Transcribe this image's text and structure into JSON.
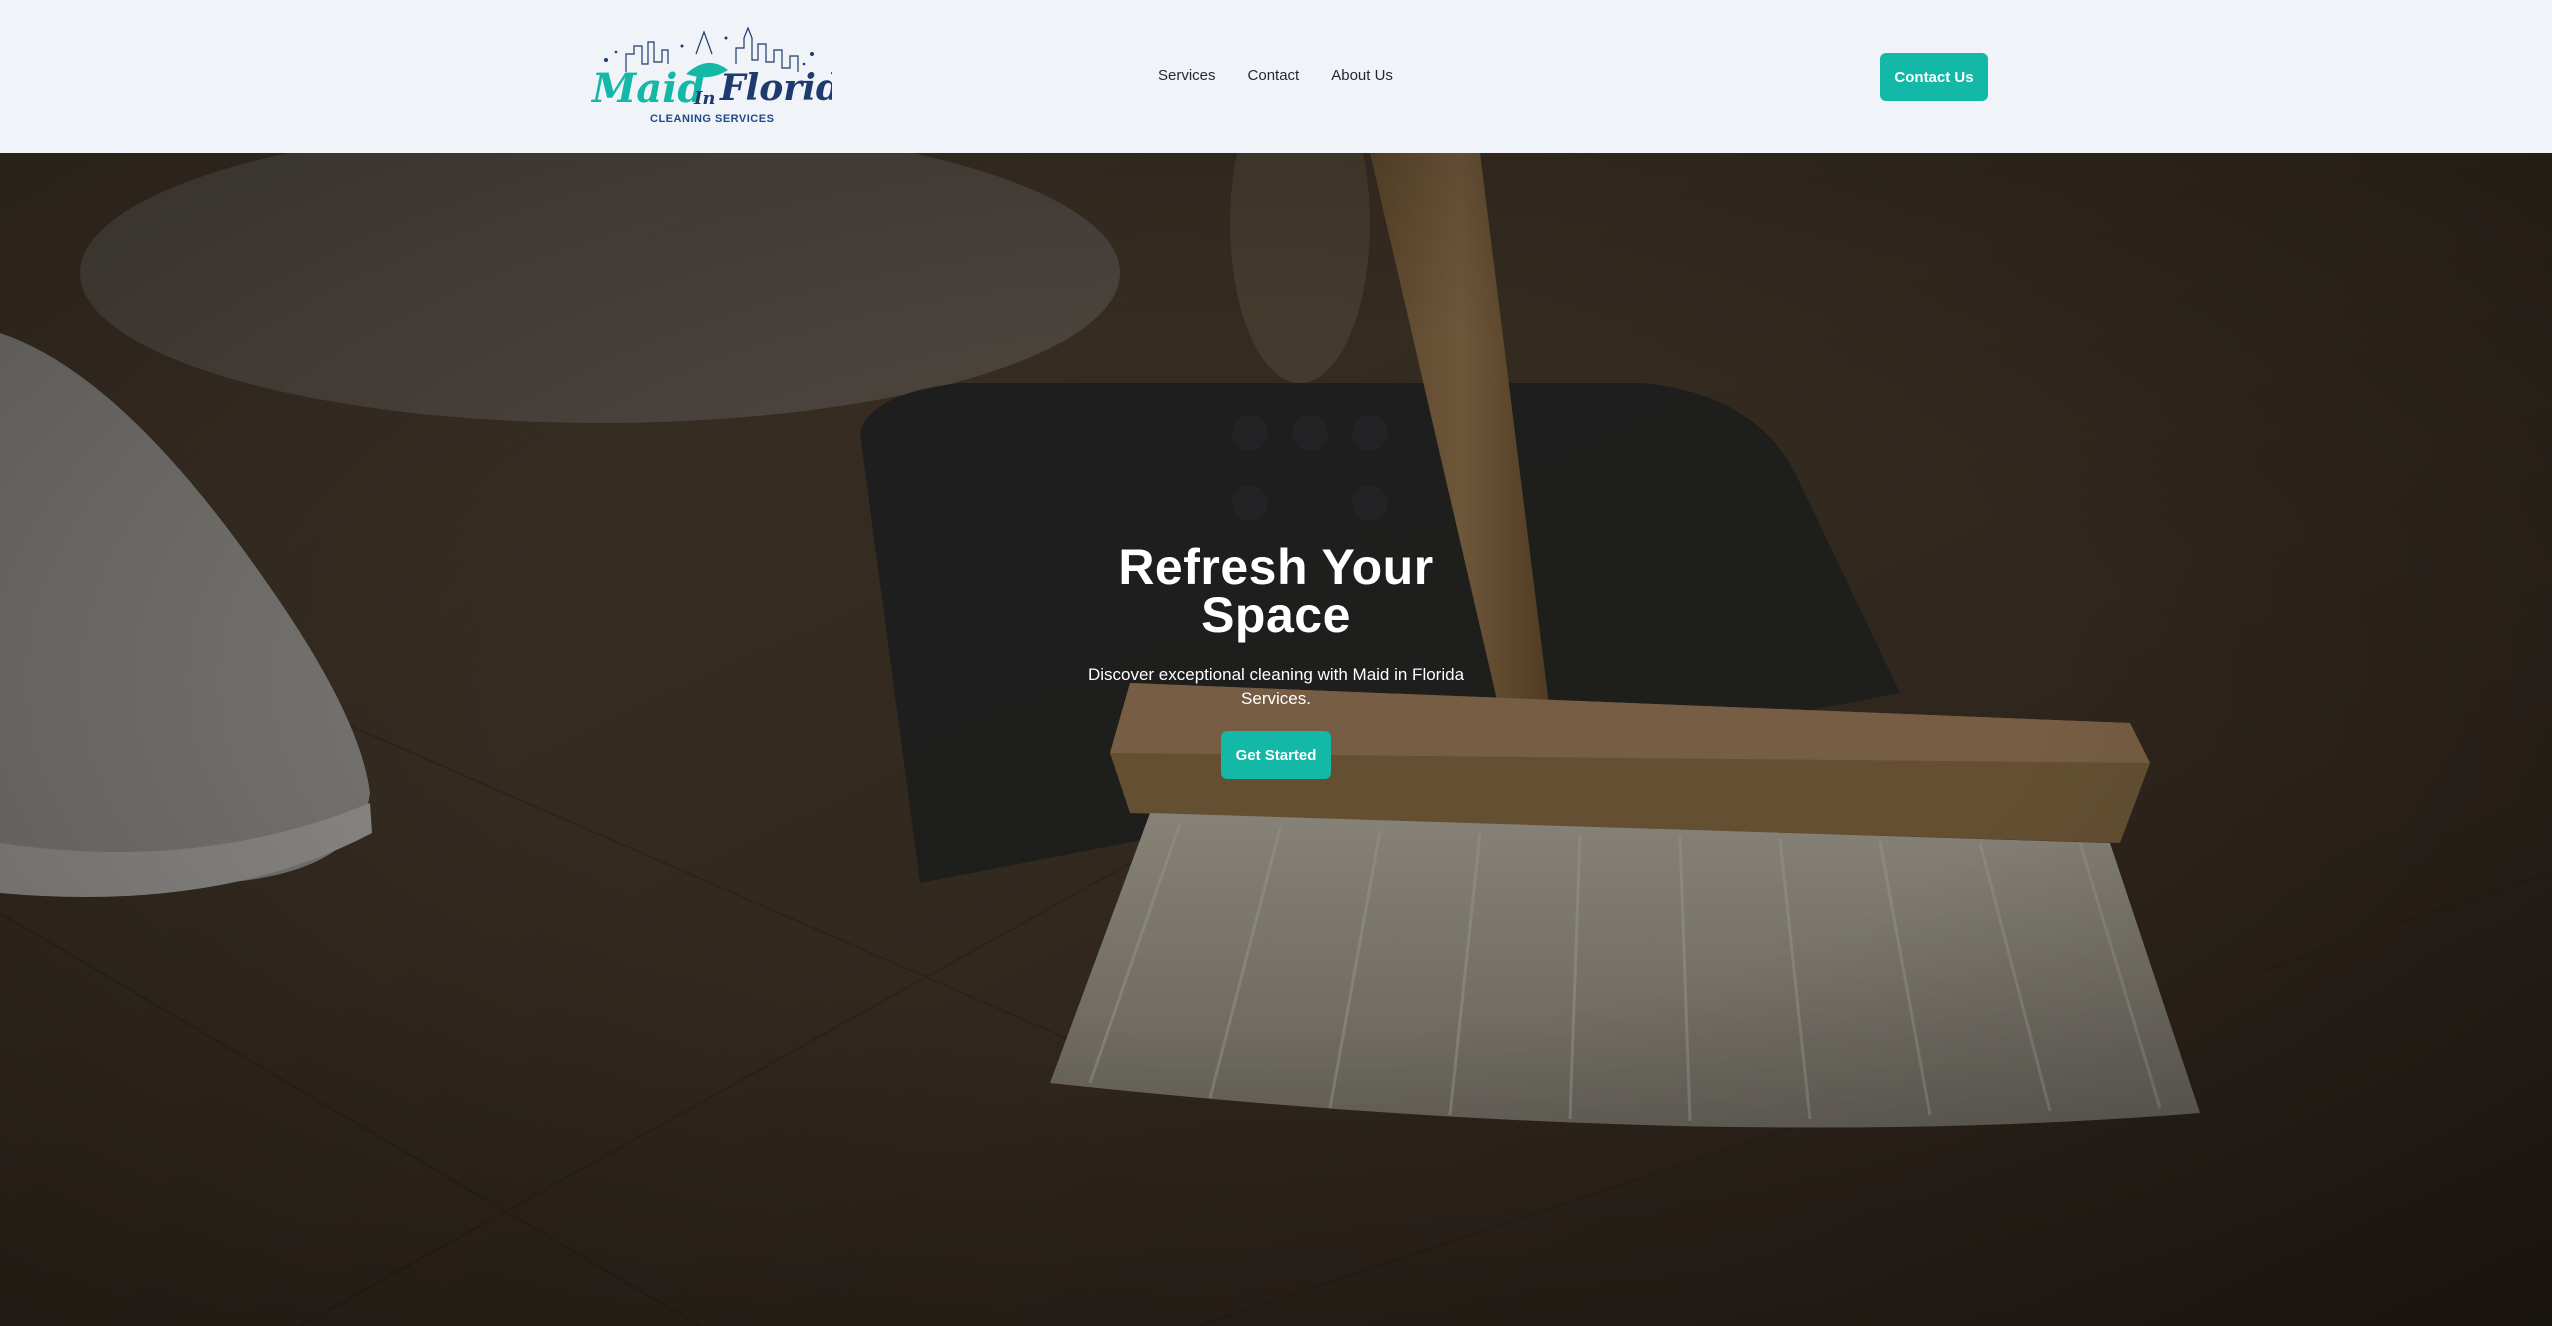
{
  "brand": {
    "script_left": "Maid",
    "script_mid": "In",
    "script_right": "Florida",
    "tagline": "CLEANING SERVICES",
    "colors": {
      "teal": "#14b8a6",
      "navy": "#1e3a6e"
    }
  },
  "nav": {
    "items": [
      {
        "label": "Services"
      },
      {
        "label": "Contact"
      },
      {
        "label": "About Us"
      }
    ]
  },
  "header": {
    "cta_label": "Contact Us"
  },
  "hero": {
    "title_line1": "Refresh Your",
    "title_line2": "Space",
    "subtitle": "Discover exceptional cleaning with Maid in Florida Services.",
    "cta_label": "Get Started",
    "background": "photo of broom sweeping a wooden floor with dustpan and white sneaker"
  },
  "colors": {
    "accent": "#14b8a6",
    "header_bg": "#f0f3f7",
    "text_dark": "#1f2933"
  }
}
